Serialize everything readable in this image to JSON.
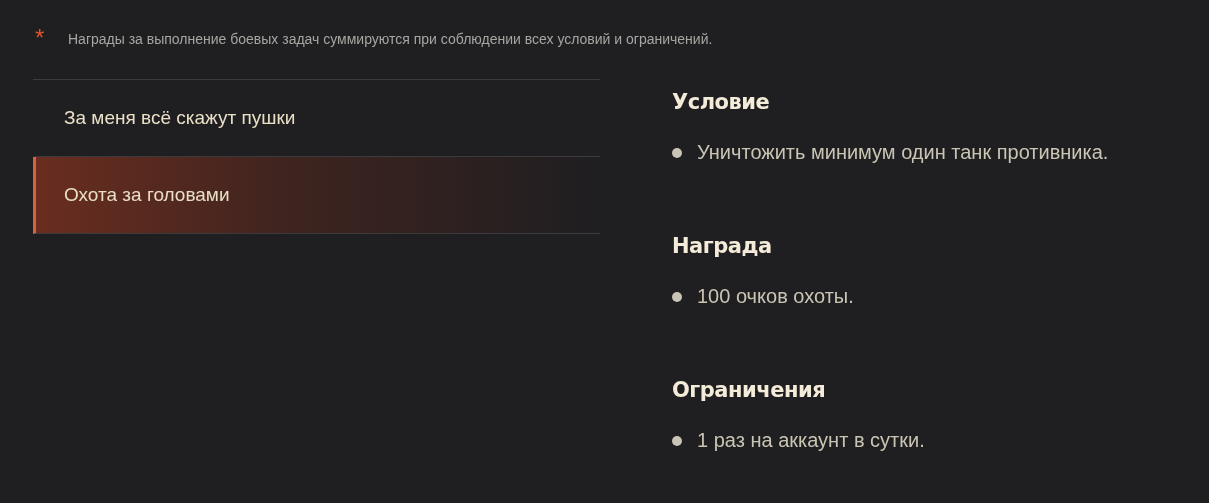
{
  "note": {
    "mark": "*",
    "text": "Награды за выполнение боевых задач суммируются при соблюдении всех условий и ограничений."
  },
  "tasks": [
    {
      "label": "За меня всё скажут пушки",
      "selected": false
    },
    {
      "label": "Охота за головами",
      "selected": true
    }
  ],
  "sections": [
    {
      "title": "Условие",
      "items": [
        "Уничтожить минимум один танк противника."
      ]
    },
    {
      "title": "Награда",
      "items": [
        "100 очков охоты."
      ]
    },
    {
      "title": "Ограничения",
      "items": [
        "1 раз на аккаунт в сутки."
      ]
    }
  ]
}
